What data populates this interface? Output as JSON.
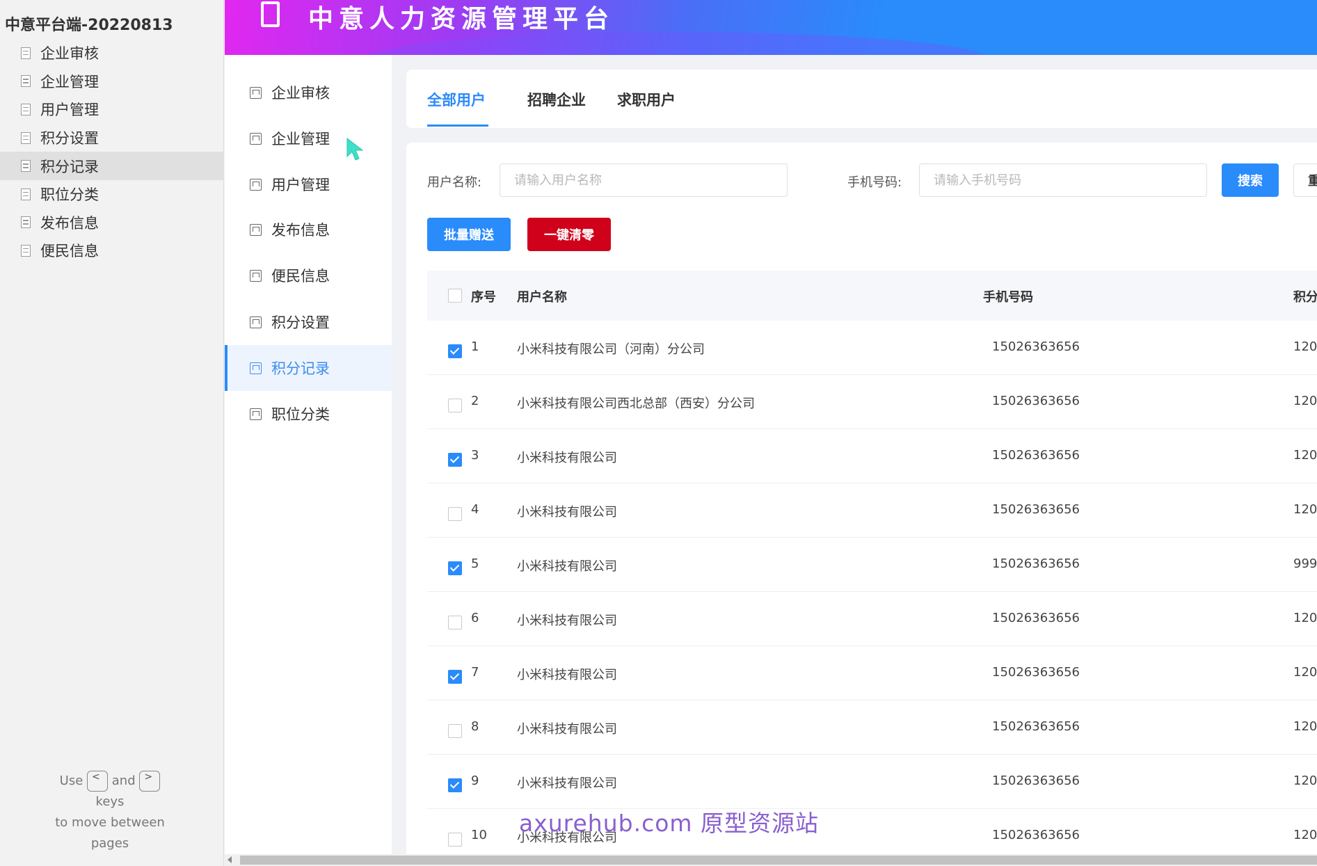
{
  "project": {
    "title": "中意平台端-20220813",
    "pages": [
      "企业审核",
      "企业管理",
      "用户管理",
      "积分设置",
      "积分记录",
      "职位分类",
      "发布信息",
      "便民信息"
    ],
    "active_page": "积分记录"
  },
  "help": {
    "use": "Use",
    "and": "and",
    "key_prev": "<",
    "key_next": ">",
    "line2": "keys",
    "line3": "to move between",
    "line4": "pages"
  },
  "banner": {
    "title": "中意人力资源管理平台"
  },
  "menu": {
    "items": [
      "企业审核",
      "企业管理",
      "用户管理",
      "发布信息",
      "便民信息",
      "积分设置",
      "积分记录",
      "职位分类"
    ],
    "active": "积分记录"
  },
  "tabs": {
    "items": [
      "全部用户",
      "招聘企业",
      "求职用户"
    ],
    "active": "全部用户"
  },
  "filters": {
    "username_label": "用户名称:",
    "username_placeholder": "请输入用户名称",
    "phone_label": "手机号码:",
    "phone_placeholder": "请输入手机号码",
    "search_label": "搜索",
    "reset_label": "重"
  },
  "actions": {
    "batch_gift": "批量赠送",
    "clear_all": "一键清零"
  },
  "table": {
    "columns": [
      "序号",
      "用户名称",
      "手机号码",
      "积分"
    ],
    "rows": [
      {
        "index": "1",
        "name": "小米科技有限公司（河南）分公司",
        "phone": "15026363656",
        "points": "120",
        "checked": true
      },
      {
        "index": "2",
        "name": "小米科技有限公司西北总部（西安）分公司",
        "phone": "15026363656",
        "points": "120",
        "checked": false
      },
      {
        "index": "3",
        "name": "小米科技有限公司",
        "phone": "15026363656",
        "points": "120",
        "checked": true
      },
      {
        "index": "4",
        "name": "小米科技有限公司",
        "phone": "15026363656",
        "points": "120",
        "checked": false
      },
      {
        "index": "5",
        "name": "小米科技有限公司",
        "phone": "15026363656",
        "points": "999",
        "checked": true
      },
      {
        "index": "6",
        "name": "小米科技有限公司",
        "phone": "15026363656",
        "points": "120",
        "checked": false
      },
      {
        "index": "7",
        "name": "小米科技有限公司",
        "phone": "15026363656",
        "points": "120",
        "checked": true
      },
      {
        "index": "8",
        "name": "小米科技有限公司",
        "phone": "15026363656",
        "points": "120",
        "checked": false
      },
      {
        "index": "9",
        "name": "小米科技有限公司",
        "phone": "15026363656",
        "points": "120",
        "checked": true
      },
      {
        "index": "10",
        "name": "小米科技有限公司",
        "phone": "15026363656",
        "points": "120",
        "checked": false
      }
    ]
  },
  "watermark": "axurehub.com 原型资源站",
  "colors": {
    "primary": "#2a8bfb",
    "danger": "#d0021b",
    "banner_start": "#e227f0",
    "banner_end": "#2a8bfb"
  }
}
